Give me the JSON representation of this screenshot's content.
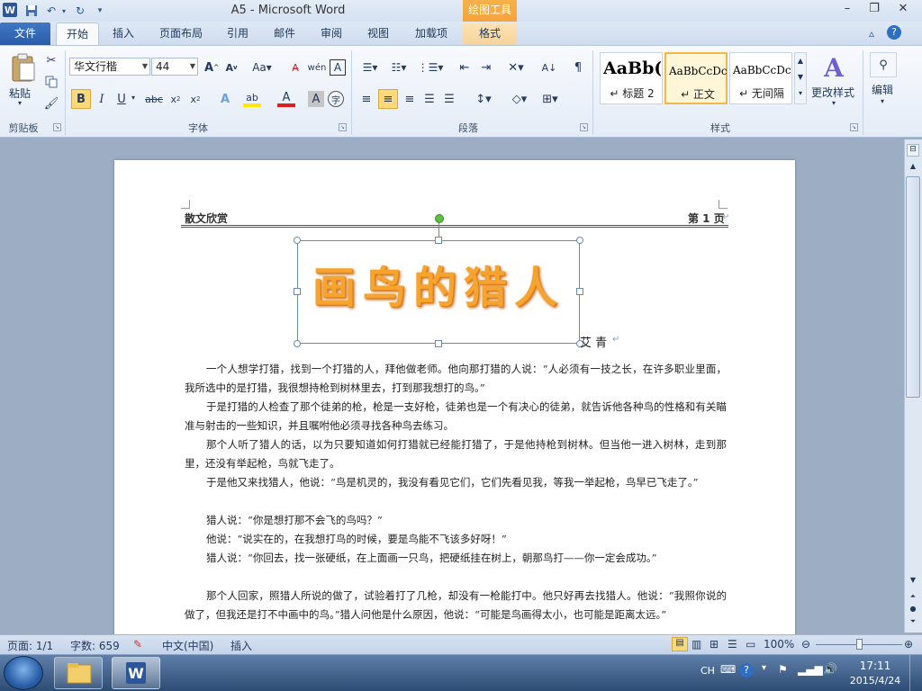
{
  "window": {
    "title": "A5 - Microsoft Word",
    "contextual_tab_group": "绘图工具",
    "minimize": "–",
    "restore": "❐",
    "close": "✕"
  },
  "quick_access": {
    "save_icon": "save-icon",
    "undo_icon": "undo-icon",
    "redo_icon": "redo-icon",
    "customize_icon": "dropdown-icon"
  },
  "tabs": [
    {
      "label": "文件"
    },
    {
      "label": "开始"
    },
    {
      "label": "插入"
    },
    {
      "label": "页面布局"
    },
    {
      "label": "引用"
    },
    {
      "label": "邮件"
    },
    {
      "label": "审阅"
    },
    {
      "label": "视图"
    },
    {
      "label": "加载项"
    },
    {
      "label": "格式"
    }
  ],
  "ribbon": {
    "clipboard": {
      "label": "剪贴板",
      "paste": "粘贴"
    },
    "font": {
      "label": "字体",
      "font_name": "华文行楷",
      "font_size": "44"
    },
    "paragraph": {
      "label": "段落"
    },
    "styles": {
      "label": "样式",
      "items": [
        {
          "sample": "AaBb(",
          "name": "↵ 标题 2"
        },
        {
          "sample": "AaBbCcDc",
          "name": "↵ 正文"
        },
        {
          "sample": "AaBbCcDc",
          "name": "↵ 无间隔"
        }
      ],
      "change_styles": "更改样式"
    },
    "editing": {
      "label": "编辑"
    }
  },
  "document": {
    "header_left": "散文欣赏",
    "header_right": "第 1 页",
    "wordart_title": "画鸟的猎人",
    "author": "艾 青",
    "paragraphs": [
      "一个人想学打猎，找到一个打猎的人，拜他做老师。他向那打猎的人说：“人必须有一技之长，在许多职业里面，我所选中的是打猎，我很想持枪到树林里去，打到那我想打的鸟。”",
      "于是打猎的人检查了那个徒弟的枪，枪是一支好枪，徒弟也是一个有决心的徒弟，就告诉他各种鸟的性格和有关瞄准与射击的一些知识，并且嘱咐他必须寻找各种鸟去练习。",
      "那个人听了猎人的话，以为只要知道如何打猎就已经能打猎了，于是他持枪到树林。但当他一进入树林，走到那里，还没有举起枪，鸟就飞走了。",
      "于是他又来找猎人，他说：“鸟是机灵的，我没有看见它们，它们先看见我，等我一举起枪，鸟早已飞走了。”",
      "猎人说：“你是想打那不会飞的鸟吗？”",
      "他说：“说实在的，在我想打鸟的时候，要是鸟能不飞该多好呀！”",
      "猎人说：“你回去，找一张硬纸，在上面画一只鸟，把硬纸挂在树上，朝那鸟打——你一定会成功。”",
      "那个人回家，照猎人所说的做了，试验着打了几枪，却没有一枪能打中。他只好再去找猎人。他说：“我照你说的做了，但我还是打不中画中的鸟。”猎人问他是什么原因，他说：“可能是鸟画得太小，也可能是距离太远。”"
    ]
  },
  "statusbar": {
    "page": "页面: 1/1",
    "words": "字数: 659",
    "language": "中文(中国)",
    "mode": "插入",
    "zoom": "100%"
  },
  "taskbar": {
    "time": "17:11",
    "date": "2015/4/24",
    "ime": "CH"
  }
}
